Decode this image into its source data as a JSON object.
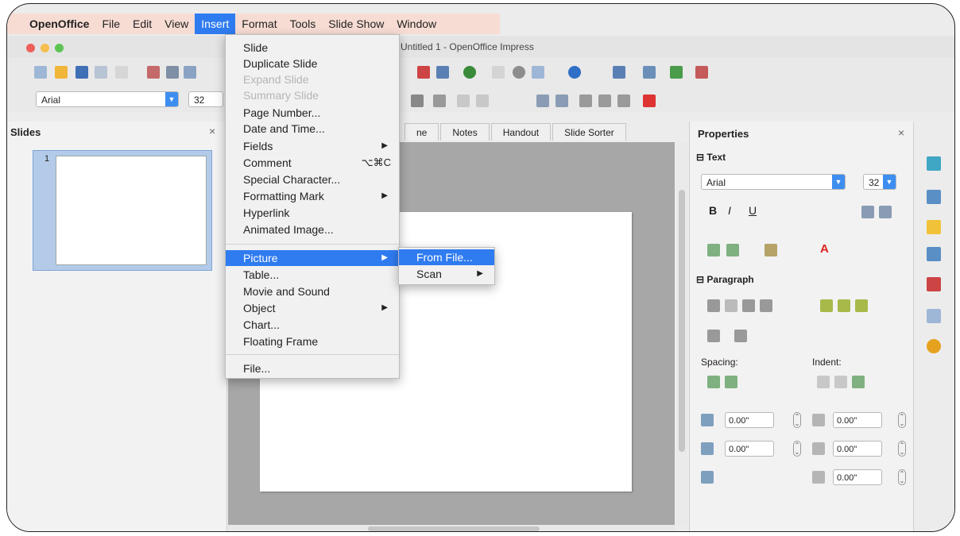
{
  "menubar": {
    "app": "OpenOffice",
    "items": [
      "File",
      "Edit",
      "View",
      "Insert",
      "Format",
      "Tools",
      "Slide Show",
      "Window"
    ],
    "active": "Insert"
  },
  "window": {
    "title": "Untitled 1 - OpenOffice Impress"
  },
  "format_toolbar": {
    "font_name": "Arial",
    "font_size": "32"
  },
  "slides_pane": {
    "title": "Slides",
    "close": "×",
    "thumb_number": "1"
  },
  "view_tabs": [
    "ne",
    "Notes",
    "Handout",
    "Slide Sorter"
  ],
  "insert_menu": {
    "items": [
      {
        "label": "Slide",
        "enabled": true
      },
      {
        "label": "Duplicate Slide",
        "enabled": true
      },
      {
        "label": "Expand Slide",
        "enabled": false
      },
      {
        "label": "Summary Slide",
        "enabled": false
      },
      {
        "label": "Page Number...",
        "enabled": true
      },
      {
        "label": "Date and Time...",
        "enabled": true
      },
      {
        "label": "Fields",
        "enabled": true,
        "submenu": true
      },
      {
        "label": "Comment",
        "enabled": true,
        "shortcut": "⌥⌘C"
      },
      {
        "label": "Special Character...",
        "enabled": true
      },
      {
        "label": "Formatting Mark",
        "enabled": true,
        "submenu": true
      },
      {
        "label": "Hyperlink",
        "enabled": true
      },
      {
        "label": "Animated Image...",
        "enabled": true
      },
      {
        "label": "Picture",
        "enabled": true,
        "submenu": true,
        "highlighted": true
      },
      {
        "label": "Table...",
        "enabled": true
      },
      {
        "label": "Movie and Sound",
        "enabled": true
      },
      {
        "label": "Object",
        "enabled": true,
        "submenu": true
      },
      {
        "label": "Chart...",
        "enabled": true
      },
      {
        "label": "Floating Frame",
        "enabled": true
      },
      {
        "label": "File...",
        "enabled": true
      }
    ]
  },
  "picture_submenu": {
    "items": [
      {
        "label": "From File...",
        "highlighted": true
      },
      {
        "label": "Scan",
        "submenu": true
      }
    ]
  },
  "properties": {
    "title": "Properties",
    "close": "×",
    "text_section": {
      "title": "Text",
      "font": "Arial",
      "size": "32",
      "bold": "B",
      "italic": "I",
      "underline": "U",
      "font_color": "A"
    },
    "paragraph_section": {
      "title": "Paragraph",
      "spacing_label": "Spacing:",
      "indent_label": "Indent:",
      "above": "0.00\"",
      "below": "0.00\"",
      "before_text": "0.00\"",
      "after_text": "0.00\"",
      "first_line": "0.00\""
    }
  },
  "colors": {
    "accent": "#2f7bf0",
    "menubar_bg": "#f7dcd3",
    "workspace": "#a7a7a7",
    "thumb_selection": "#b3cbe9"
  }
}
